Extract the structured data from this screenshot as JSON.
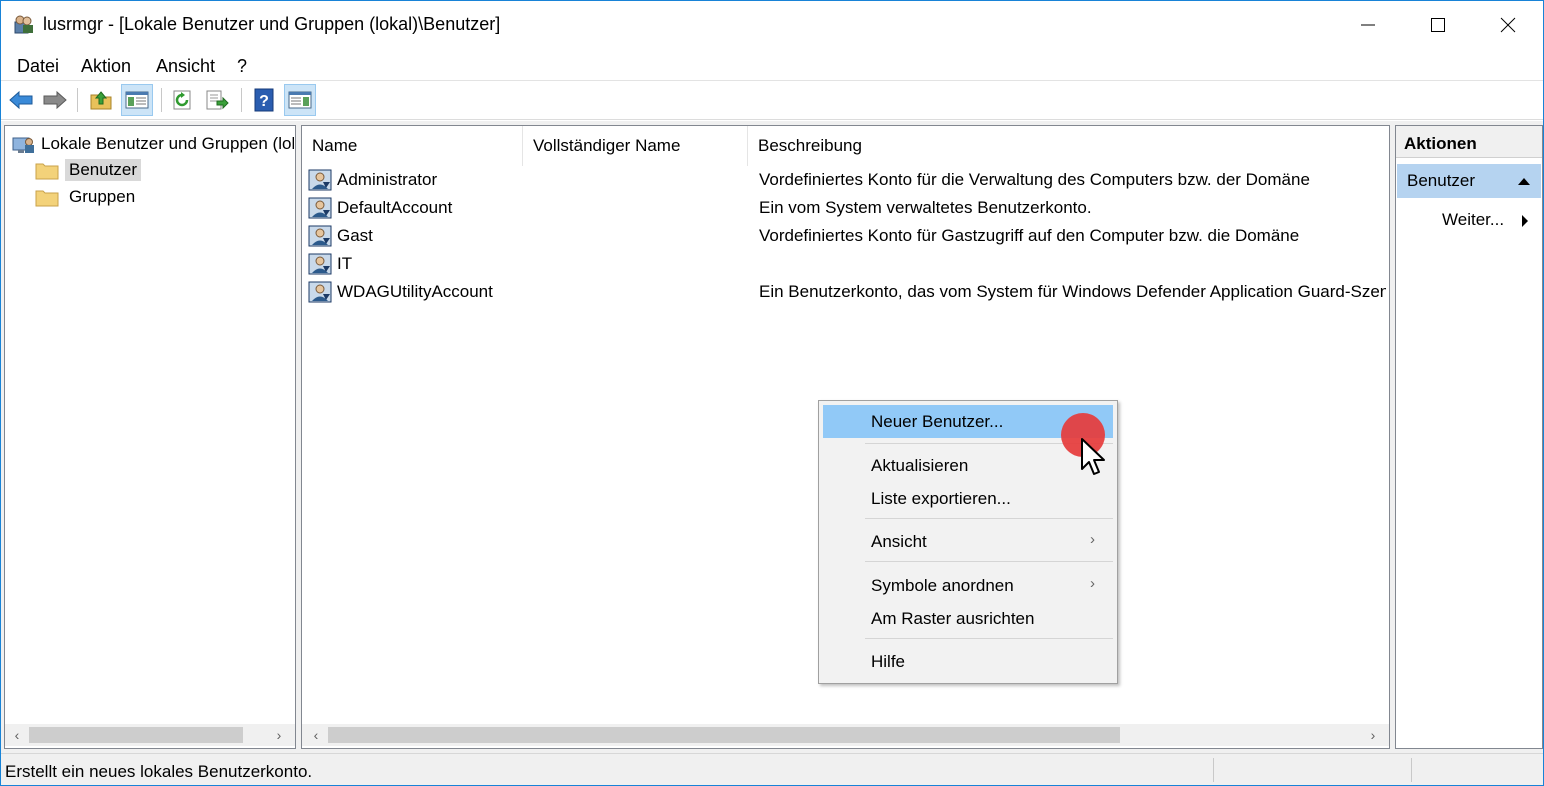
{
  "window": {
    "title": "lusrmgr - [Lokale Benutzer und Gruppen (lokal)\\Benutzer]"
  },
  "menubar": {
    "items": [
      "Datei",
      "Aktion",
      "Ansicht",
      "?"
    ]
  },
  "tree": {
    "root_label": "Lokale Benutzer und Gruppen (lokal)",
    "items": [
      {
        "label": "Benutzer",
        "selected": true
      },
      {
        "label": "Gruppen",
        "selected": false
      }
    ]
  },
  "list": {
    "columns": [
      "Name",
      "Vollständiger Name",
      "Beschreibung"
    ],
    "rows": [
      {
        "name": "Administrator",
        "fullname": "",
        "description": "Vordefiniertes Konto für die Verwaltung des Computers bzw. der Domäne"
      },
      {
        "name": "DefaultAccount",
        "fullname": "",
        "description": "Ein vom System verwaltetes Benutzerkonto."
      },
      {
        "name": "Gast",
        "fullname": "",
        "description": "Vordefiniertes Konto für Gastzugriff auf den Computer bzw. die Domäne"
      },
      {
        "name": "IT",
        "fullname": "",
        "description": ""
      },
      {
        "name": "WDAGUtilityAccount",
        "fullname": "",
        "description": "Ein Benutzerkonto, das vom System für Windows Defender Application Guard-Szenarien verwaltet und verwendet wird."
      }
    ]
  },
  "actions": {
    "header": "Aktionen",
    "section": "Benutzer",
    "more": "Weiter..."
  },
  "context_menu": {
    "items": [
      {
        "label": "Neuer Benutzer...",
        "highlighted": true
      },
      {
        "label": "Aktualisieren"
      },
      {
        "label": "Liste exportieren..."
      },
      {
        "label": "Ansicht",
        "submenu": true
      },
      {
        "label": "Symbole anordnen",
        "submenu": true
      },
      {
        "label": "Am Raster ausrichten"
      },
      {
        "label": "Hilfe"
      }
    ]
  },
  "statusbar": {
    "text": "Erstellt ein neues lokales Benutzerkonto."
  },
  "colors": {
    "accent_border": "#1883d7",
    "menu_highlight": "#91c9f7",
    "actions_section": "#b5d3f0",
    "cursor_marker": "#e63b3b"
  }
}
